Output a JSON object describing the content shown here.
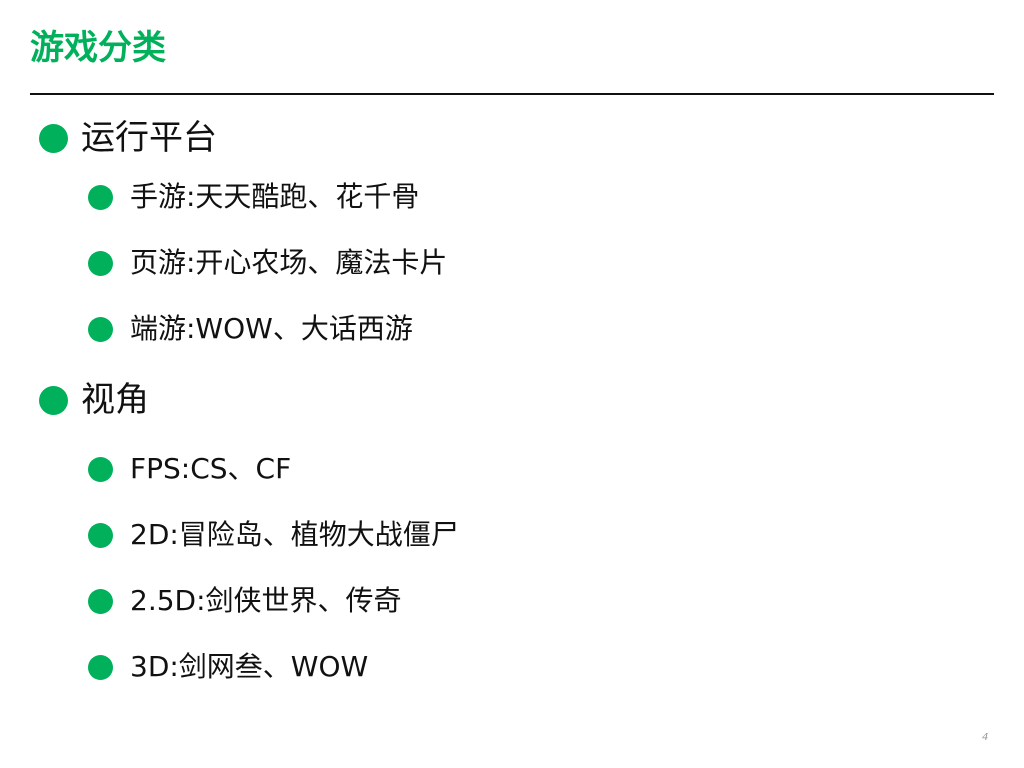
{
  "slide": {
    "title": "游戏分类",
    "accent_color": "#00b05a",
    "page_number": "4"
  },
  "sections": [
    {
      "label": "运行平台",
      "items": [
        "手游:天天酷跑、花千骨",
        "页游:开心农场、魔法卡片",
        "端游:WOW、大话西游"
      ]
    },
    {
      "label": "视角",
      "items": [
        "FPS:CS、CF",
        "2D:冒险岛、植物大战僵尸",
        "2.5D:剑侠世界、传奇",
        "3D:剑网叁、WOW"
      ]
    }
  ]
}
